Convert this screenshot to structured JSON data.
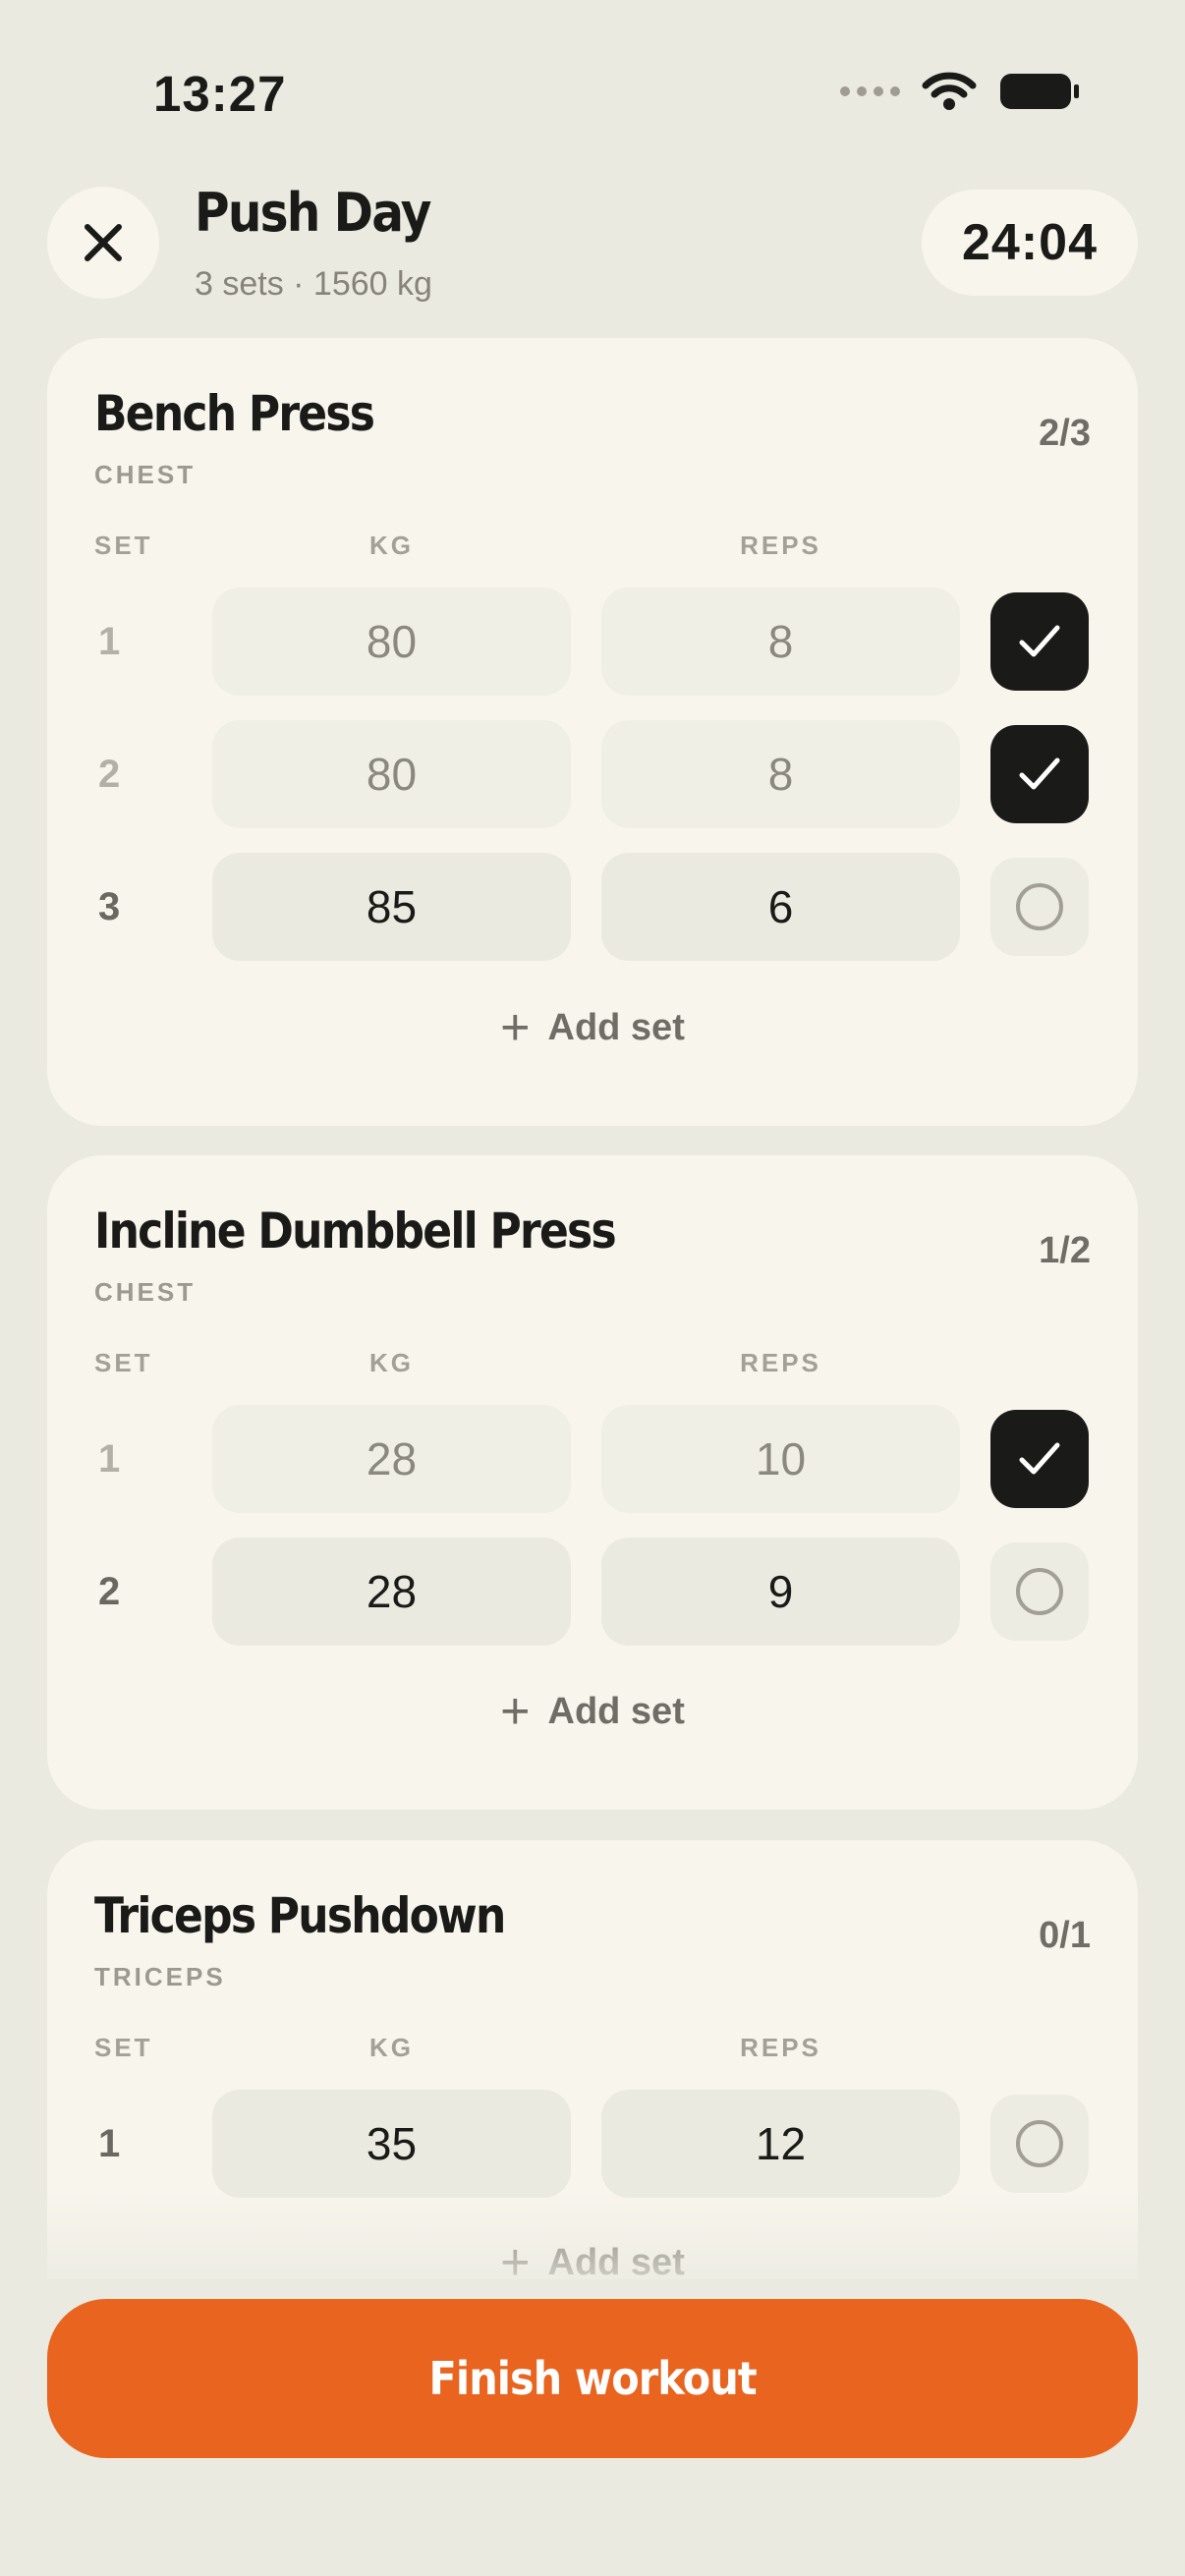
{
  "status_bar": {
    "time": "13:27"
  },
  "header": {
    "title": "Push Day",
    "subtitle": "3 sets · 1560 kg",
    "timer": "24:04"
  },
  "columns": {
    "set": "SET",
    "kg": "KG",
    "reps": "REPS"
  },
  "add_set_label": "Add set",
  "exercises": [
    {
      "name": "Bench Press",
      "muscle": "CHEST",
      "progress": "2/3",
      "sets": [
        {
          "num": "1",
          "kg": "80",
          "reps": "8",
          "done": true
        },
        {
          "num": "2",
          "kg": "80",
          "reps": "8",
          "done": true
        },
        {
          "num": "3",
          "kg": "85",
          "reps": "6",
          "done": false
        }
      ]
    },
    {
      "name": "Incline Dumbbell Press",
      "muscle": "CHEST",
      "progress": "1/2",
      "sets": [
        {
          "num": "1",
          "kg": "28",
          "reps": "10",
          "done": true
        },
        {
          "num": "2",
          "kg": "28",
          "reps": "9",
          "done": false
        }
      ]
    },
    {
      "name": "Triceps Pushdown",
      "muscle": "TRICEPS",
      "progress": "0/1",
      "sets": [
        {
          "num": "1",
          "kg": "35",
          "reps": "12",
          "done": false
        }
      ]
    }
  ],
  "finish_button": {
    "label": "Finish workout"
  },
  "colors": {
    "accent": "#E8641F",
    "background": "#EBEAE1",
    "card": "#F7F5EC",
    "check_on": "#1A1A18"
  }
}
